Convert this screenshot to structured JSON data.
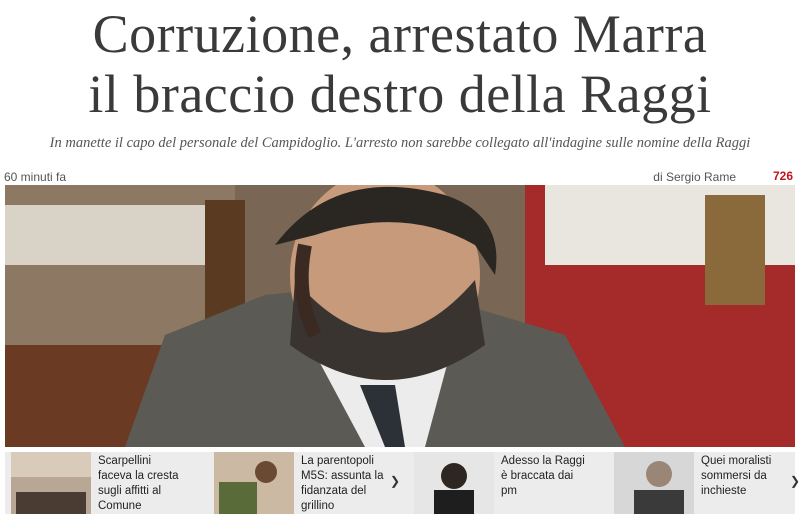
{
  "article": {
    "headline_line1": "Corruzione, arrestato Marra",
    "headline_line2": "il braccio destro della Raggi",
    "subtitle": "In manette il capo del personale del Campidoglio. L'arresto non sarebbe collegato all'indagine sulle nomine della Raggi",
    "time_ago": "60 minuti fa",
    "author": "di Sergio Rame",
    "comment_count": "726"
  },
  "related": [
    {
      "text": "Scarpellini faceva la cresta sugli affitti al Comune"
    },
    {
      "text": "La parentopoli M5S: assunta la fidanzata del grillino"
    },
    {
      "text": "Adesso la Raggi è braccata dai pm"
    },
    {
      "text": "Quei moralisti sommersi da inchieste"
    }
  ],
  "icons": {
    "next": "chevron-right-icon"
  },
  "colors": {
    "accent": "#c0161b",
    "headline": "#3a3a3a",
    "strip_bg": "#ececec"
  }
}
